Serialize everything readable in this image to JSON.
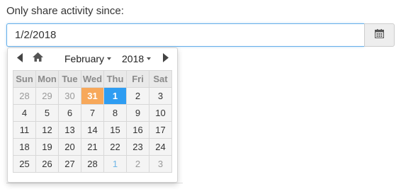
{
  "field": {
    "label": "Only share activity since:",
    "value": "1/2/2018"
  },
  "datepicker": {
    "month_label": "February",
    "year_label": "2018",
    "weekdays": [
      "Sun",
      "Mon",
      "Tue",
      "Wed",
      "Thu",
      "Fri",
      "Sat"
    ],
    "weeks": [
      [
        {
          "d": "28",
          "s": "other"
        },
        {
          "d": "29",
          "s": "other"
        },
        {
          "d": "30",
          "s": "other"
        },
        {
          "d": "31",
          "s": "today"
        },
        {
          "d": "1",
          "s": "selected"
        },
        {
          "d": "2",
          "s": ""
        },
        {
          "d": "3",
          "s": ""
        }
      ],
      [
        {
          "d": "4",
          "s": ""
        },
        {
          "d": "5",
          "s": ""
        },
        {
          "d": "6",
          "s": ""
        },
        {
          "d": "7",
          "s": ""
        },
        {
          "d": "8",
          "s": ""
        },
        {
          "d": "9",
          "s": ""
        },
        {
          "d": "10",
          "s": ""
        }
      ],
      [
        {
          "d": "11",
          "s": ""
        },
        {
          "d": "12",
          "s": ""
        },
        {
          "d": "13",
          "s": ""
        },
        {
          "d": "14",
          "s": ""
        },
        {
          "d": "15",
          "s": ""
        },
        {
          "d": "16",
          "s": ""
        },
        {
          "d": "17",
          "s": ""
        }
      ],
      [
        {
          "d": "18",
          "s": ""
        },
        {
          "d": "19",
          "s": ""
        },
        {
          "d": "20",
          "s": ""
        },
        {
          "d": "21",
          "s": ""
        },
        {
          "d": "22",
          "s": ""
        },
        {
          "d": "23",
          "s": ""
        },
        {
          "d": "24",
          "s": ""
        }
      ],
      [
        {
          "d": "25",
          "s": ""
        },
        {
          "d": "26",
          "s": ""
        },
        {
          "d": "27",
          "s": ""
        },
        {
          "d": "28",
          "s": ""
        },
        {
          "d": "1",
          "s": "next-other"
        },
        {
          "d": "2",
          "s": "other"
        },
        {
          "d": "3",
          "s": "other"
        }
      ]
    ]
  },
  "icons": {
    "calendar": "calendar-icon",
    "prev": "triangle-left-icon",
    "home": "home-icon",
    "next": "triangle-right-icon"
  },
  "colors": {
    "focus_border": "#66afe9",
    "today": "#f7a85a",
    "selected": "#2e9df2",
    "next_month_day": "#6fb6e6"
  }
}
